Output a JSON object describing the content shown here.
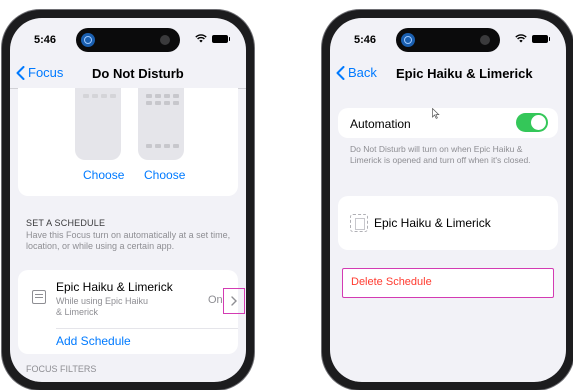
{
  "left_phone": {
    "status_time": "5:46",
    "back_label": "Focus",
    "title": "Do Not Disturb",
    "choose_labels": [
      "Choose",
      "Choose"
    ],
    "section_header": "SET A SCHEDULE",
    "section_description": "Have this Focus turn on automatically at a set time, location, or while using a certain app.",
    "schedule": {
      "title": "Epic Haiku & Limerick",
      "subtitle": "While using Epic Haiku & Limerick",
      "status": "On"
    },
    "add_schedule_label": "Add Schedule",
    "next_section_header": "FOCUS FILTERS"
  },
  "right_phone": {
    "status_time": "5:46",
    "back_label": "Back",
    "title": "Epic Haiku & Limerick",
    "automation_label": "Automation",
    "automation_on": true,
    "automation_description": "Do Not Disturb will turn on when Epic Haiku & Limerick is opened and turn off when it's closed.",
    "app_name": "Epic Haiku & Limerick",
    "delete_label": "Delete Schedule"
  },
  "colors": {
    "accent": "#007aff",
    "destructive": "#ff3b30",
    "toggle_on": "#34c759",
    "highlight": "#d33bb3"
  }
}
